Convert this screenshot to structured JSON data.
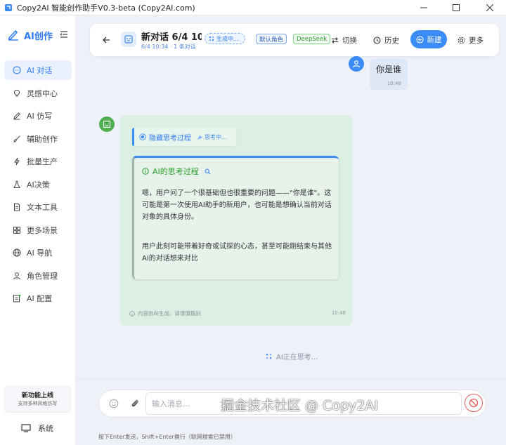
{
  "window": {
    "title": "Copy2AI 智能创作助手V0.3-beta (Copy2AI.com)"
  },
  "sidebar": {
    "brand": "AI创作",
    "items": [
      {
        "label": "AI 对话",
        "icon": "chat-icon",
        "active": true
      },
      {
        "label": "灵感中心",
        "icon": "lightbulb-icon"
      },
      {
        "label": "AI 仿写",
        "icon": "pen-icon"
      },
      {
        "label": "辅助创作",
        "icon": "brush-icon"
      },
      {
        "label": "批量生产",
        "icon": "lightning-icon"
      },
      {
        "label": "AI决策",
        "icon": "flask-icon"
      },
      {
        "label": "文本工具",
        "icon": "document-icon"
      },
      {
        "label": "更多场景",
        "icon": "grid-icon"
      },
      {
        "label": "AI 导航",
        "icon": "globe-icon"
      },
      {
        "label": "角色管理",
        "icon": "user-icon"
      },
      {
        "label": "AI 配置",
        "icon": "settings-doc-icon"
      }
    ],
    "promo": {
      "title": "新功能上线",
      "subtitle": "支持多种风格仿写"
    },
    "system_label": "系统"
  },
  "header": {
    "title": "新对话 6/4 10:",
    "subtitle": "6/4 10:34 · 1 条对话",
    "generating_badge": "生成中...",
    "role_tag": "默认角色",
    "model_tag": "DeepSeek",
    "switch_label": "切换",
    "history_label": "历史",
    "new_label": "新建",
    "more_label": "更多"
  },
  "messages": {
    "user": {
      "text": "你是谁",
      "time": "10:48"
    },
    "ai": {
      "toggle_label": "隐藏思考过程",
      "thinking_label": "思考中...",
      "think_title": "AI的思考过程",
      "paragraph1": "嗯，用户问了一个很基础但也很重要的问题——\"你是谁\"。这可能是第一次使用AI助手的新用户，也可能是想确认当前对话对象的具体身份。",
      "paragraph2": "用户此刻可能带着好奇或试探的心态，甚至可能刚结束与其他AI的对话想来对比",
      "footer": "内容由AI生成，请谨慎甄别",
      "time": "10:48"
    },
    "status": "AI正在思考..."
  },
  "input": {
    "placeholder": "输入消息...",
    "hint": "按下Enter发送，Shift+Enter换行（联网搜索已禁用）"
  },
  "watermark": "掘金技术社区 @ Copy2AI",
  "colors": {
    "accent": "#3b8cf7",
    "ai_bubble": "#dcefe3",
    "think_title": "#2aa02a",
    "stop": "#e25b5b"
  }
}
